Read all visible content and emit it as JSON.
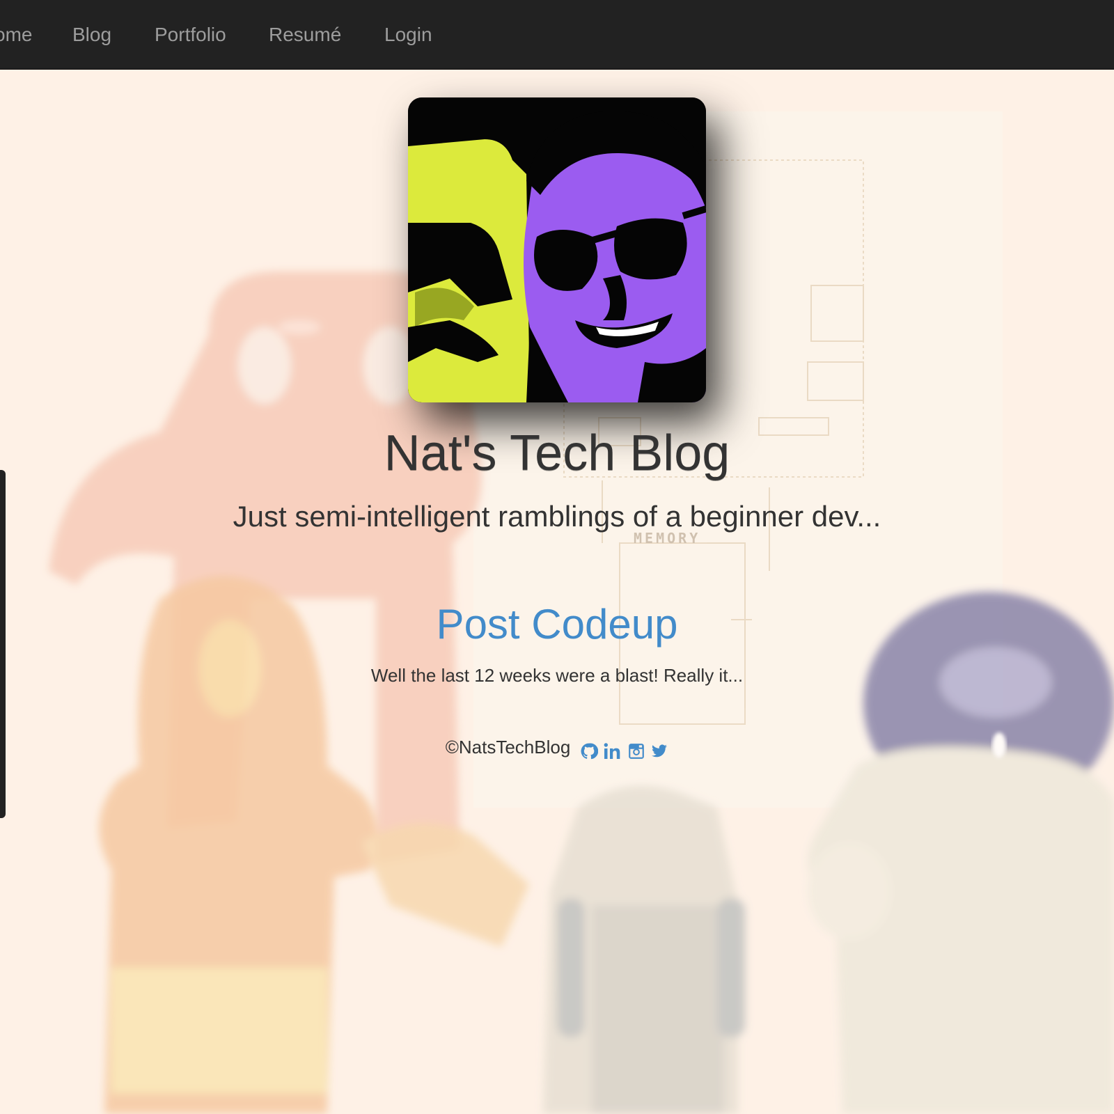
{
  "nav": {
    "items": [
      "ome",
      "Blog",
      "Portfolio",
      "Resumé",
      "Login"
    ]
  },
  "hero": {
    "title": "Nat's Tech Blog",
    "subtitle": "Just semi-intelligent ramblings of a beginner dev..."
  },
  "post": {
    "title": "Post Codeup",
    "excerpt": "Well the last 12 weeks were a blast! Really it..."
  },
  "background": {
    "diagram_label": "MEMORY"
  },
  "footer": {
    "copyright": "©NatsTechBlog",
    "social": [
      "github-icon",
      "linkedin-icon",
      "instagram-icon",
      "twitter-icon"
    ]
  },
  "colors": {
    "navbar": "#222222",
    "nav_text": "#9d9d9d",
    "link": "#428bca",
    "text": "#333333",
    "avatar_yellow": "#dcea3c",
    "avatar_purple": "#9b5cf0"
  }
}
